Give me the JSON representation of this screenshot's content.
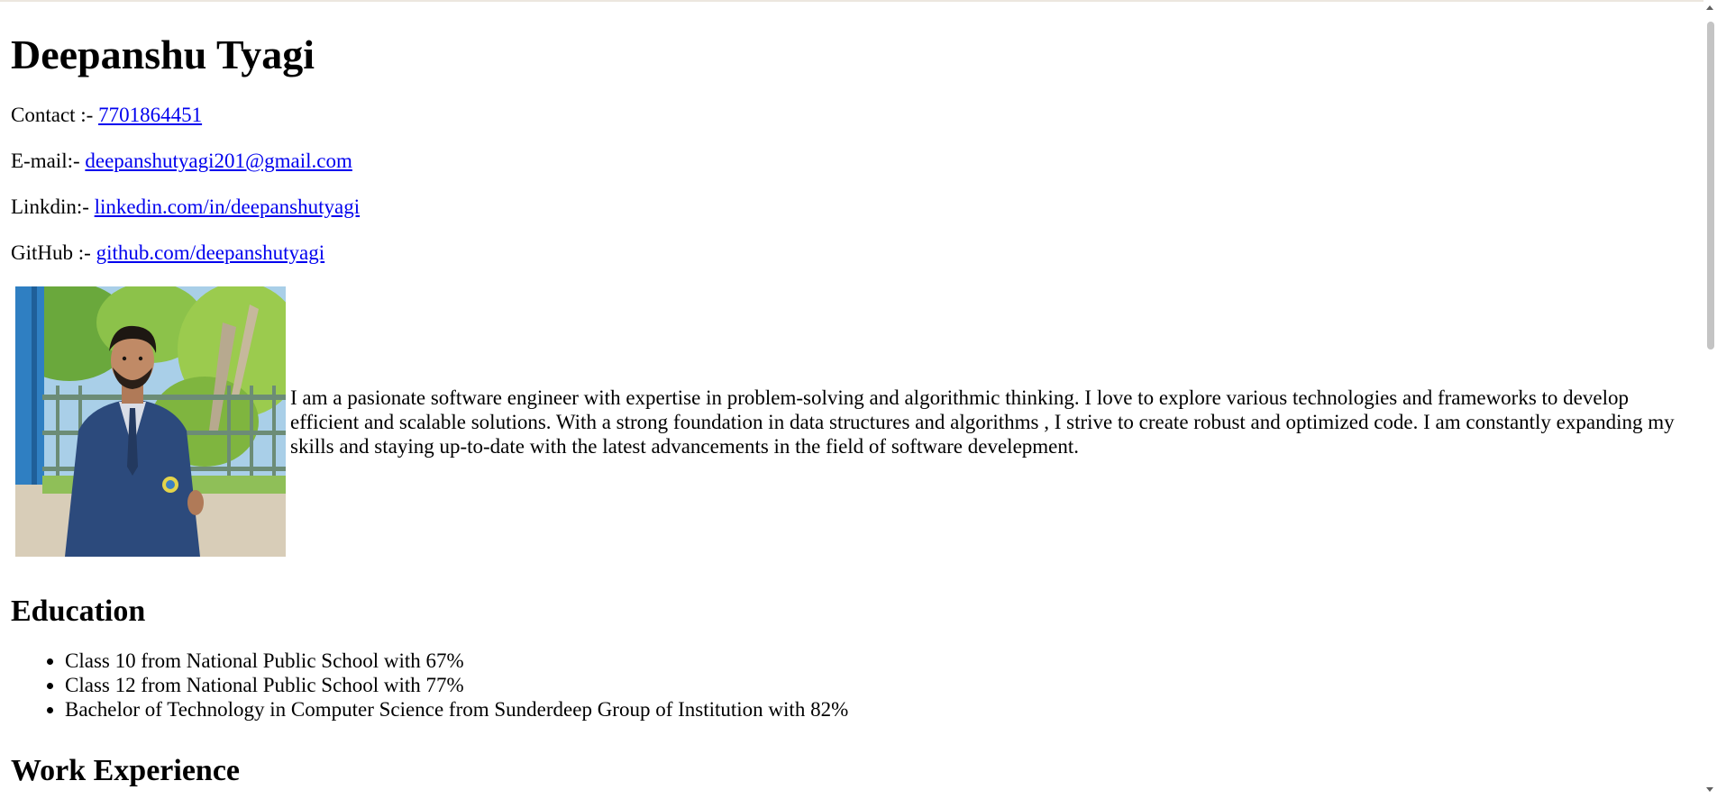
{
  "header": {
    "name": "Deepanshu Tyagi"
  },
  "contact": {
    "phone_label": "Contact :- ",
    "phone_value": "7701864451",
    "email_label": "E-mail:- ",
    "email_value": "deepanshutyagi201@gmail.com",
    "linkedin_label": "Linkdin:- ",
    "linkedin_value": "linkedin.com/in/deepanshutyagi",
    "github_label": "GitHub :- ",
    "github_value": "github.com/deepanshutyagi"
  },
  "about": {
    "text": "I am a pasionate software engineer with expertise in problem-solving and algorithmic thinking. I love to explore various technologies and frameworks to develop efficient and scalable solutions. With a strong foundation in data structures and algorithms , I strive to create robust and optimized code. I am constantly expanding my skills and staying up-to-date with the latest advancements in the field of software develepment."
  },
  "education": {
    "heading": "Education",
    "items": [
      "Class 10 from National Public School with 67%",
      "Class 12 from National Public School with 77%",
      "Bachelor of Technology in Computer Science from Sunderdeep Group of Institution with 82%"
    ]
  },
  "work": {
    "heading": "Work Experience"
  },
  "colors": {
    "link": "#0000ee",
    "text": "#000000"
  }
}
